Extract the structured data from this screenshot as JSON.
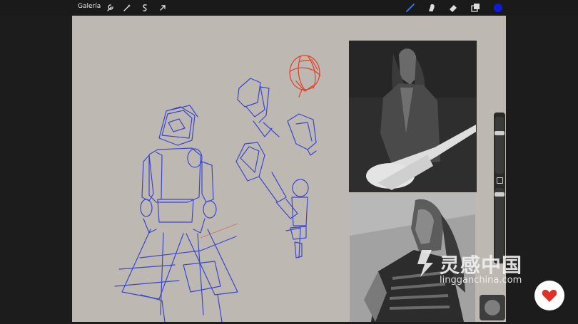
{
  "topbar": {
    "gallery_label": "Galería",
    "left_tools": [
      "wrench-icon",
      "magic-wand-icon",
      "selection-icon",
      "transform-arrow-icon"
    ],
    "right_tools": [
      "brush-icon",
      "smudge-icon",
      "eraser-icon",
      "layers-icon",
      "color-swatch"
    ],
    "active_color": "#0f1cd6"
  },
  "canvas": {
    "background": "#bdb8b1",
    "stroke_colors": {
      "sketch": "#2f3bd0",
      "highlight": "#e23a22"
    }
  },
  "sidebar": {
    "controls": [
      "brush-size-slider",
      "modify-button",
      "opacity-slider"
    ]
  },
  "watermark": {
    "text": "灵感中国",
    "url": "lingganchina.com"
  }
}
